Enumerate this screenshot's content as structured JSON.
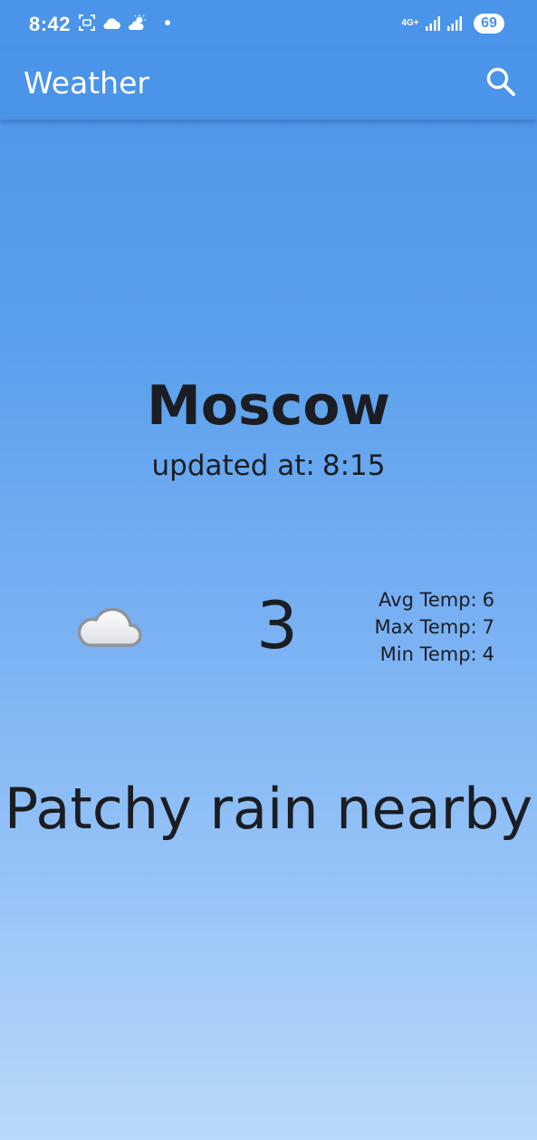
{
  "status_bar": {
    "time": "8:42",
    "network_label": "4G+",
    "battery_level": "69",
    "icons": [
      "screenshot-icon",
      "cloud-icon",
      "partly-sunny-icon",
      "notification-dot-icon",
      "signal-icon",
      "signal-icon",
      "battery-icon"
    ]
  },
  "app_bar": {
    "title": "Weather",
    "search_icon": "search-icon"
  },
  "weather": {
    "city": "Moscow",
    "updated_label": "updated at:",
    "updated_time": "8:15",
    "condition_icon": "cloud-icon",
    "current_temp": "3",
    "details": [
      {
        "label": "Avg Temp:",
        "value": "6"
      },
      {
        "label": "Max Temp:",
        "value": "7"
      },
      {
        "label": "Min Temp:",
        "value": "4"
      }
    ],
    "condition": "Patchy rain nearby"
  },
  "colors": {
    "primary": "#4a94e9",
    "gradient_top": "#4a94e9",
    "gradient_bottom": "#b8d9f9",
    "text": "#1b1d22"
  }
}
